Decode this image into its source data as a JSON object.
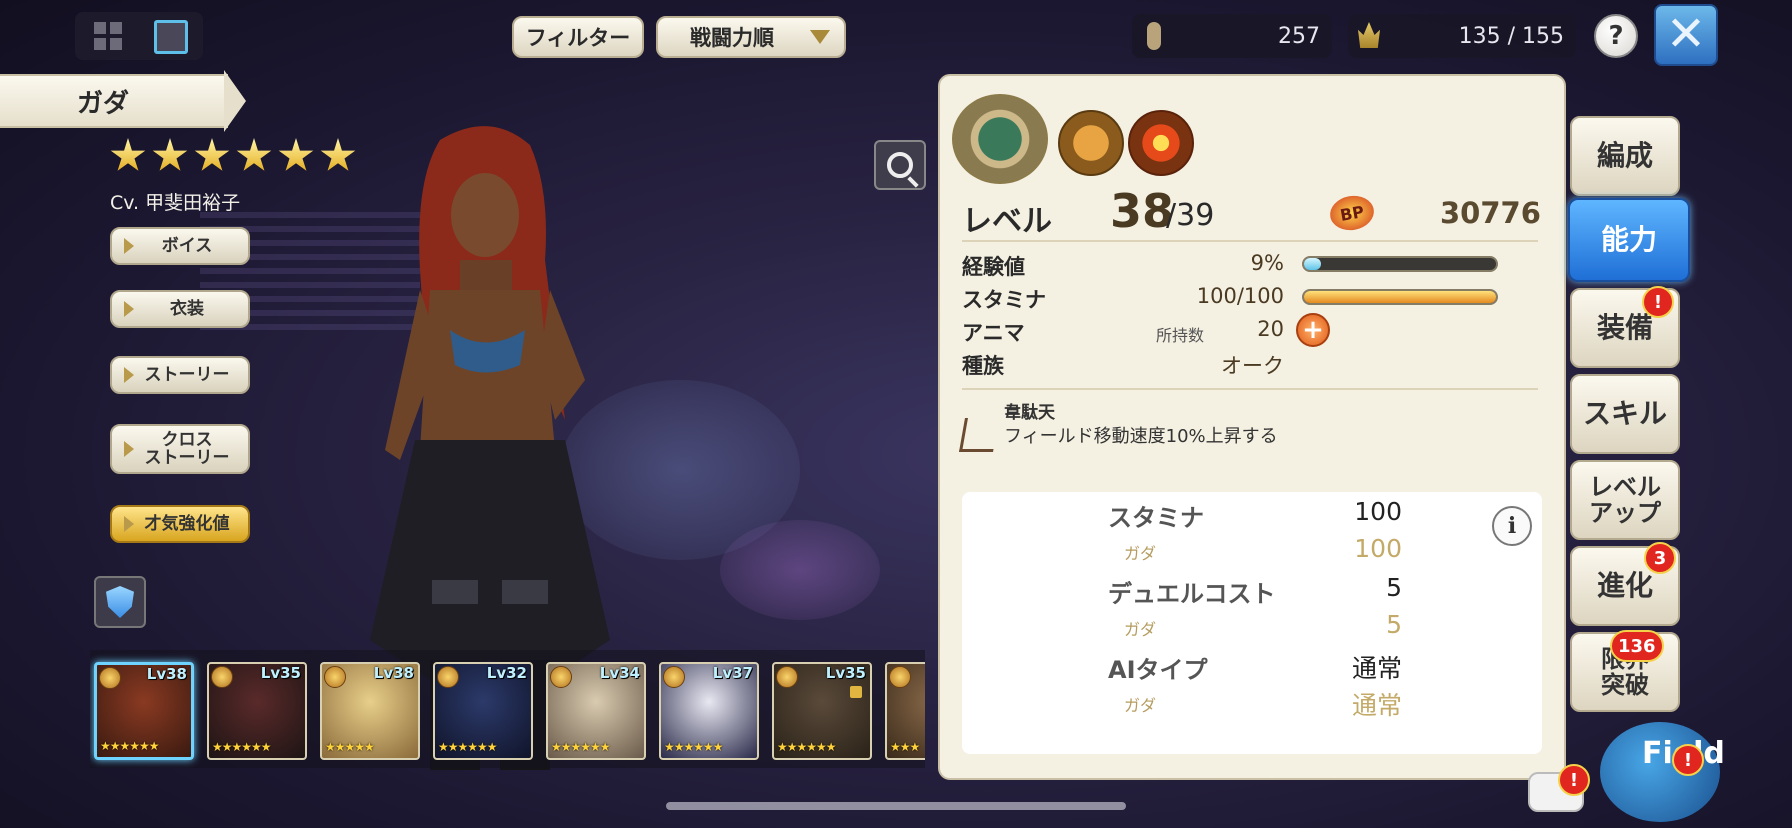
{
  "colors": {
    "accent_blue": "#1f6fd6",
    "badge_red": "#e0261f",
    "panel_bg": "#f4f0e2",
    "gold": "#c4aa68"
  },
  "topbar": {
    "filter_label": "フィルター",
    "sort_label": "戦闘力順",
    "unit_count": "257",
    "capacity": "135 / 155",
    "help_label": "?",
    "close_label": "✕"
  },
  "character": {
    "name": "ガダ",
    "rarity_stars": 6,
    "voice_actor": "Cv. 甲斐田裕子"
  },
  "side_menu": {
    "voice": "ボイス",
    "costume": "衣装",
    "story": "ストーリー",
    "cross_story": "クロス\nストーリー",
    "talent": "才気強化値"
  },
  "roster": [
    {
      "level": "Lv38",
      "stars": "★★★★★★",
      "selected": true
    },
    {
      "level": "Lv35",
      "stars": "★★★★★★",
      "selected": false
    },
    {
      "level": "Lv38",
      "stars": "★★★★★",
      "selected": false
    },
    {
      "level": "Lv32",
      "stars": "★★★★★★",
      "selected": false
    },
    {
      "level": "Lv34",
      "stars": "★★★★★★",
      "selected": false
    },
    {
      "level": "Lv37",
      "stars": "★★★★★★",
      "selected": false
    },
    {
      "level": "Lv35",
      "stars": "★★★★★★",
      "selected": false
    },
    {
      "level": "",
      "stars": "★★★",
      "selected": false
    }
  ],
  "panel": {
    "level_label": "レベル",
    "level_current": "38",
    "level_max": "/39",
    "bp_icon": "BP",
    "bp_value": "30776",
    "exp_label": "経験値",
    "exp_value": "9%",
    "exp_fraction": 0.09,
    "stamina_label": "スタミナ",
    "stamina_value": "100/100",
    "stamina_fraction": 1.0,
    "anima_label": "アニマ",
    "anima_owned_label": "所持数",
    "anima_value": "20",
    "race_label": "種族",
    "race_value": "オーク",
    "trait_name": "韋駄天",
    "trait_desc": "フィールド移動速度10%上昇する"
  },
  "stat_box": {
    "info_label": "i",
    "rows": [
      {
        "label": "スタミナ",
        "value": "100",
        "sub_label": "ガダ",
        "sub_value": "100"
      },
      {
        "label": "デュエルコスト",
        "value": "5",
        "sub_label": "ガダ",
        "sub_value": "5"
      },
      {
        "label": "AIタイプ",
        "value": "通常",
        "sub_label": "ガダ",
        "sub_value": "通常"
      }
    ]
  },
  "tabs": {
    "formation": "編成",
    "ability": "能力",
    "equipment": "装備",
    "skill": "スキル",
    "levelup": "レベル\nアップ",
    "evolve": "進化",
    "evolve_badge": "3",
    "limit_break": "限界\n突破",
    "limit_badge": "136",
    "alert": "!"
  },
  "field_button": "Field"
}
